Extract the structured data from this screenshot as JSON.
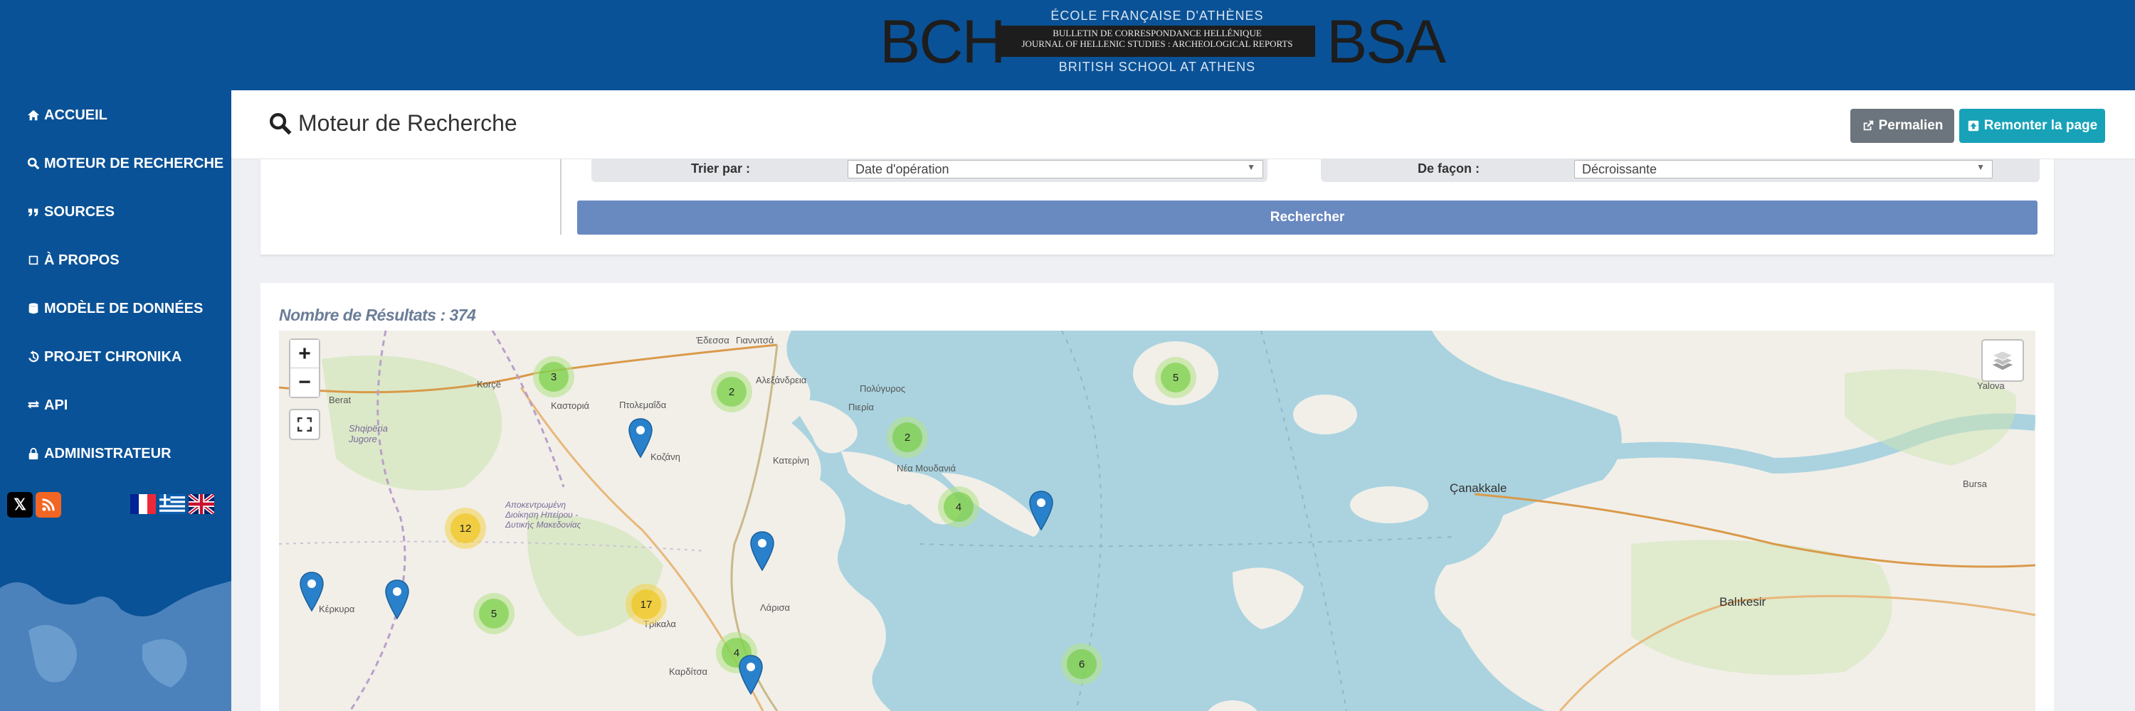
{
  "header": {
    "logo_left": "BCH",
    "logo_right": "BSA",
    "efa_line": "ÉCOLE FRANÇAISE D'ATHÈNES",
    "box_line1": "BULLETIN DE CORRESPONDANCE HELLÉNIQUE",
    "box_line2": "JOURNAL OF HELLENIC STUDIES : ARCHEOLOGICAL REPORTS",
    "bsa_line": "BRITISH SCHOOL AT ATHENS"
  },
  "sidebar": {
    "items": [
      {
        "label": "ACCUEIL",
        "icon": "home-icon"
      },
      {
        "label": "MOTEUR DE RECHERCHE",
        "icon": "search-icon"
      },
      {
        "label": "SOURCES",
        "icon": "quote-icon"
      },
      {
        "label": "À PROPOS",
        "icon": "book-icon"
      },
      {
        "label": "MODÈLE DE DONNÉES",
        "icon": "database-icon"
      },
      {
        "label": "PROJET CHRONIKA",
        "icon": "history-icon"
      },
      {
        "label": "API",
        "icon": "exchange-icon"
      },
      {
        "label": "ADMINISTRATEUR",
        "icon": "lock-icon"
      }
    ],
    "social": [
      "x-icon",
      "rss-icon"
    ],
    "languages": [
      "fr",
      "el",
      "en"
    ]
  },
  "topbar": {
    "title": "Moteur de Recherche",
    "permalink_label": "Permalien",
    "scroll_top_label": "Remonter la page",
    "colors": {
      "permalink": "#6c757d",
      "scroll_top": "#17a2b8"
    }
  },
  "search": {
    "sort_label": "Trier par :",
    "sort_value": "Date d'opération",
    "order_label": "De façon :",
    "order_value": "Décroissante",
    "submit_label": "Rechercher"
  },
  "results": {
    "count_text": "Nombre de Résultats : 374"
  },
  "map": {
    "zoom_in": "+",
    "zoom_out": "−",
    "clusters": [
      {
        "count": "3",
        "level": "green"
      },
      {
        "count": "2",
        "level": "green"
      },
      {
        "count": "2",
        "level": "green"
      },
      {
        "count": "5",
        "level": "green"
      },
      {
        "count": "4",
        "level": "green"
      },
      {
        "count": "12",
        "level": "yellow"
      },
      {
        "count": "17",
        "level": "yellow"
      },
      {
        "count": "5",
        "level": "green"
      },
      {
        "count": "4",
        "level": "green"
      },
      {
        "count": "6",
        "level": "green"
      }
    ],
    "places": [
      "Berat",
      "Korçë",
      "Καστοριά",
      "Πτολεμαΐδα",
      "Κοζάνη",
      "Έδεσσα",
      "Γιαννιτσά",
      "Αλεξάνδρεια",
      "Κατερίνη",
      "Πιερία",
      "Πολύγυρος",
      "Νέα Μουδανιά",
      "Shqipëria Jugore",
      "Αποκεντρωμένη Διοίκηση Ηπείρου - Δυτικής Μακεδονίας",
      "Κέρκυρα",
      "Τρίκαλα",
      "Λάρισα",
      "Καρδίτσα",
      "Çanakkale",
      "Balıkesir",
      "Bursa",
      "Yalova"
    ]
  }
}
